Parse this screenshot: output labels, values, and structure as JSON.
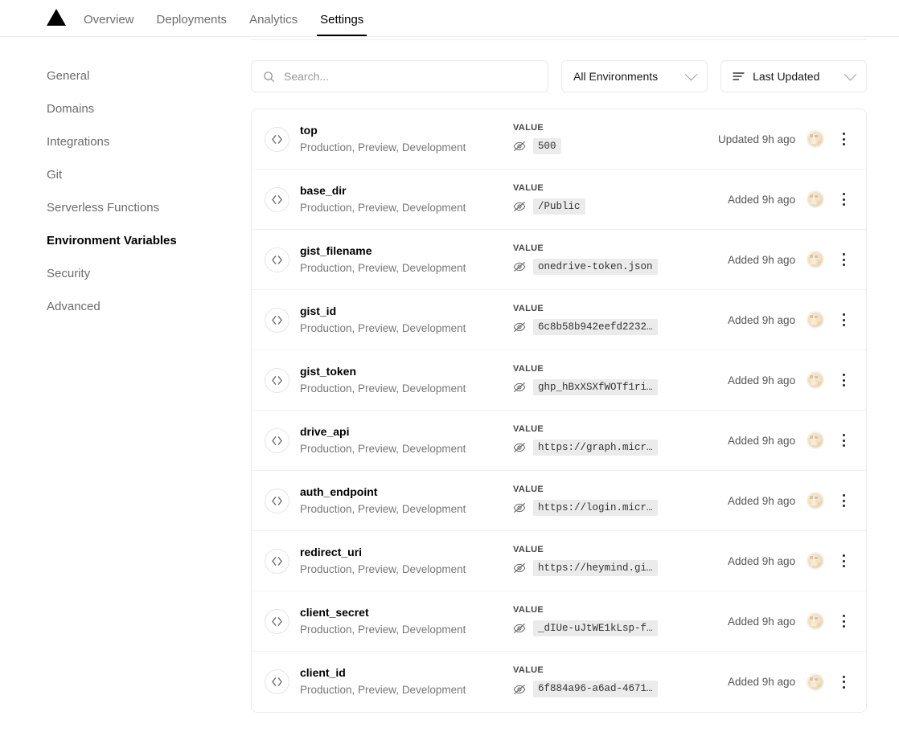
{
  "nav": {
    "logo_icon": "triangle-logo-icon",
    "items": [
      {
        "label": "Overview",
        "active": false
      },
      {
        "label": "Deployments",
        "active": false
      },
      {
        "label": "Analytics",
        "active": false
      },
      {
        "label": "Settings",
        "active": true
      }
    ]
  },
  "sidebar": {
    "items": [
      {
        "label": "General",
        "active": false
      },
      {
        "label": "Domains",
        "active": false
      },
      {
        "label": "Integrations",
        "active": false
      },
      {
        "label": "Git",
        "active": false
      },
      {
        "label": "Serverless Functions",
        "active": false
      },
      {
        "label": "Environment Variables",
        "active": true
      },
      {
        "label": "Security",
        "active": false
      },
      {
        "label": "Advanced",
        "active": false
      }
    ]
  },
  "toolbar": {
    "search": {
      "icon": "search-icon",
      "value": "",
      "placeholder": "Search..."
    },
    "environment_filter": {
      "selected": "All Environments",
      "icon": "chevron-down-icon"
    },
    "sort_filter": {
      "selected": "Last Updated",
      "leading_icon": "sort-lines-icon",
      "icon": "chevron-down-icon"
    }
  },
  "list": {
    "value_column_label": "VALUE",
    "row_icon": "code-brackets-icon",
    "hidden_icon": "eye-off-icon",
    "menu_icon": "kebab-menu-icon",
    "avatar_icon": "user-avatar",
    "rows": [
      {
        "name": "top",
        "environments": "Production, Preview, Development",
        "value_label": "VALUE",
        "value": "500",
        "meta": "Updated 9h ago"
      },
      {
        "name": "base_dir",
        "environments": "Production, Preview, Development",
        "value_label": "VALUE",
        "value": "/Public",
        "meta": "Added 9h ago"
      },
      {
        "name": "gist_filename",
        "environments": "Production, Preview, Development",
        "value_label": "VALUE",
        "value": "onedrive-token.json",
        "meta": "Added 9h ago"
      },
      {
        "name": "gist_id",
        "environments": "Production, Preview, Development",
        "value_label": "VALUE",
        "value": "6c8b58b942eefd2232…",
        "meta": "Added 9h ago"
      },
      {
        "name": "gist_token",
        "environments": "Production, Preview, Development",
        "value_label": "VALUE",
        "value": "ghp_hBxXSXfWOTf1ri…",
        "meta": "Added 9h ago"
      },
      {
        "name": "drive_api",
        "environments": "Production, Preview, Development",
        "value_label": "VALUE",
        "value": "https://graph.micr…",
        "meta": "Added 9h ago"
      },
      {
        "name": "auth_endpoint",
        "environments": "Production, Preview, Development",
        "value_label": "VALUE",
        "value": "https://login.micr…",
        "meta": "Added 9h ago"
      },
      {
        "name": "redirect_uri",
        "environments": "Production, Preview, Development",
        "value_label": "VALUE",
        "value": "https://heymind.gi…",
        "meta": "Added 9h ago"
      },
      {
        "name": "client_secret",
        "environments": "Production, Preview, Development",
        "value_label": "VALUE",
        "value": "_dIUe-uJtWE1kLsp-f…",
        "meta": "Added 9h ago"
      },
      {
        "name": "client_id",
        "environments": "Production, Preview, Development",
        "value_label": "VALUE",
        "value": "6f884a96-a6ad-4671…",
        "meta": "Added 9h ago"
      }
    ]
  },
  "colors": {
    "border": "#eaeaea",
    "chip_bg": "#ebebeb",
    "muted_text": "#777777",
    "accent": "#000000"
  }
}
